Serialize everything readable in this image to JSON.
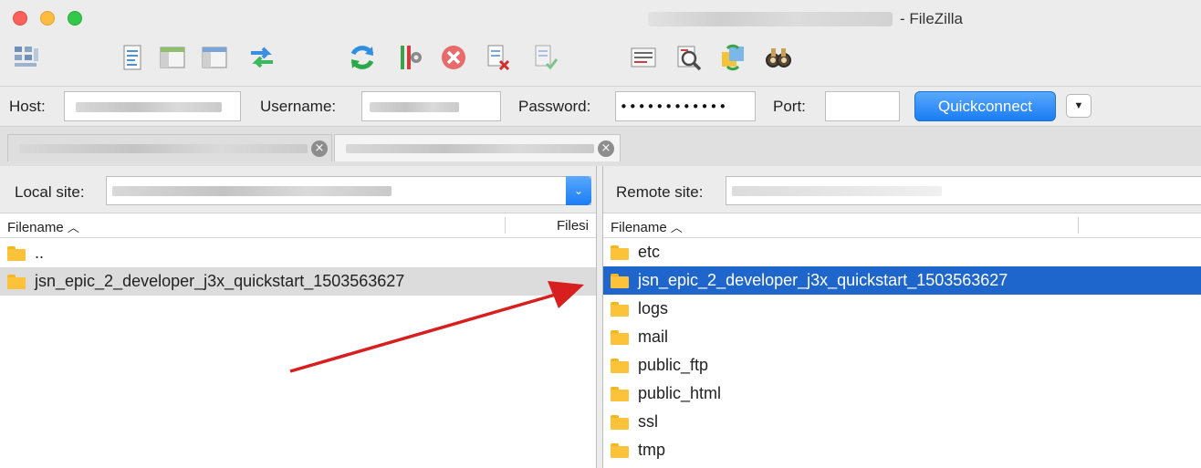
{
  "window": {
    "title": "- FileZilla",
    "colors": {
      "close": "#fc605b",
      "minimize": "#fdbc40",
      "zoom": "#34c84a"
    }
  },
  "toolbar": {
    "icons": [
      "site-manager-icon",
      "message-log-icon",
      "local-tree-icon",
      "remote-tree-icon",
      "transfer-queue-icon",
      "refresh-icon",
      "process-queue-icon",
      "cancel-icon",
      "disconnect-icon",
      "reconnect-icon",
      "filter-icon",
      "compare-icon",
      "sync-browse-icon",
      "search-icon"
    ]
  },
  "quickconnect": {
    "host_label": "Host:",
    "host_value": "",
    "username_label": "Username:",
    "username_value": "",
    "password_label": "Password:",
    "password_value": "••••••••••••",
    "port_label": "Port:",
    "port_value": "",
    "button_label": "Quickconnect",
    "dropdown_icon": "chevron-down-icon",
    "accent": "#1a7cf5"
  },
  "tabs": [
    {
      "label": "",
      "active": false
    },
    {
      "label": "",
      "active": true
    }
  ],
  "local": {
    "site_label": "Local site:",
    "site_value": "",
    "columns": [
      "Filename",
      "Filesi"
    ],
    "sort_indicator": "^",
    "files": [
      {
        "name": "..",
        "type": "folder"
      },
      {
        "name": "jsn_epic_2_developer_j3x_quickstart_1503563627",
        "type": "folder",
        "selected": true
      }
    ]
  },
  "remote": {
    "site_label": "Remote site:",
    "site_value": "",
    "columns": [
      "Filename"
    ],
    "sort_indicator": "^",
    "files": [
      {
        "name": "etc",
        "type": "folder"
      },
      {
        "name": "jsn_epic_2_developer_j3x_quickstart_1503563627",
        "type": "folder",
        "selected": true
      },
      {
        "name": "logs",
        "type": "folder"
      },
      {
        "name": "mail",
        "type": "folder"
      },
      {
        "name": "public_ftp",
        "type": "folder"
      },
      {
        "name": "public_html",
        "type": "folder"
      },
      {
        "name": "ssl",
        "type": "folder"
      },
      {
        "name": "tmp",
        "type": "folder"
      }
    ],
    "selection_color": "#1f66cc"
  },
  "annotation": {
    "arrow_color": "#d71f1f"
  }
}
